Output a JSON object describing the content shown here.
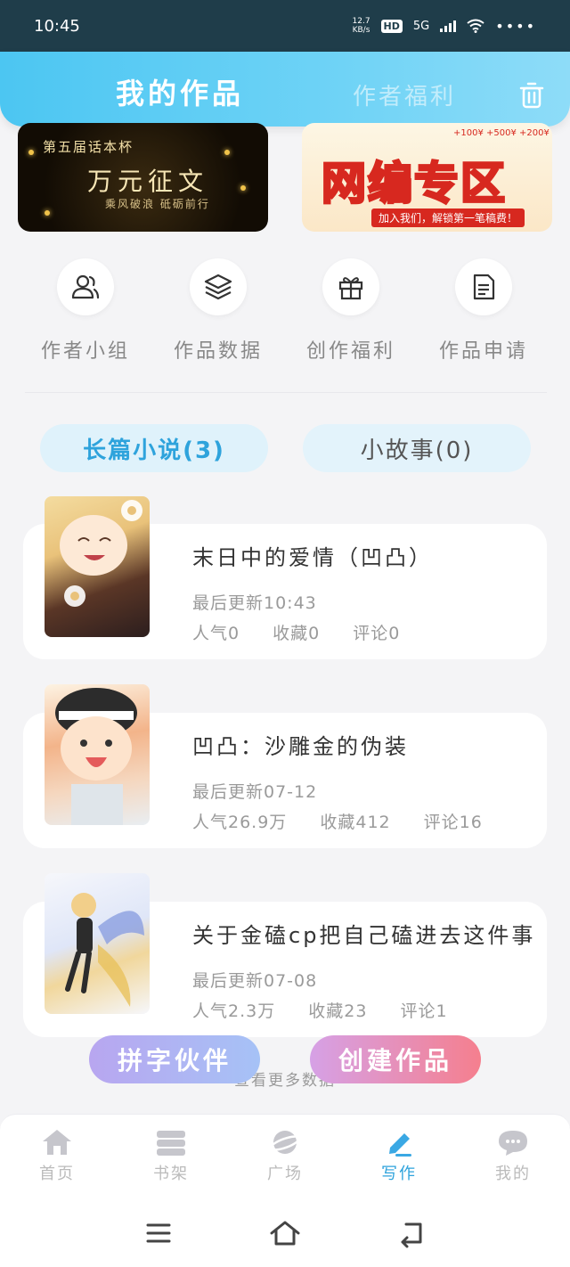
{
  "status_bar": {
    "time": "10:45",
    "net_speed_top": "12.7",
    "net_speed_bottom": "KB/s",
    "hd": "HD",
    "network": "5G",
    "more": "••••"
  },
  "header": {
    "title": "我的作品",
    "tab_welfare": "作者福利",
    "trash_icon": "trash-icon"
  },
  "banners": [
    {
      "line1": "第五届话本杯",
      "line2": "万元征文",
      "line3": "乘风破浪 砥砺前行"
    },
    {
      "main": "网编专区",
      "sub": "加入我们，解锁第一笔稿费！",
      "money": "+100¥  +500¥  +200¥"
    }
  ],
  "quick_actions": [
    {
      "label": "作者小组",
      "icon": "group-icon"
    },
    {
      "label": "作品数据",
      "icon": "layers-icon"
    },
    {
      "label": "创作福利",
      "icon": "gift-icon"
    },
    {
      "label": "作品申请",
      "icon": "document-icon"
    }
  ],
  "tabs": {
    "long": "长篇小说(3)",
    "short": "小故事(0)"
  },
  "works": [
    {
      "title": "末日中的爱情（凹凸）",
      "updated": "最后更新10:43",
      "popularity": "人气0",
      "favorites": "收藏0",
      "comments": "评论0"
    },
    {
      "title": "凹凸：沙雕金的伪装",
      "updated": "最后更新07-12",
      "popularity": "人气26.9万",
      "favorites": "收藏412",
      "comments": "评论16"
    },
    {
      "title": "关于金磕cp把自己磕进去这件事",
      "updated": "最后更新07-08",
      "popularity": "人气2.3万",
      "favorites": "收藏23",
      "comments": "评论1"
    }
  ],
  "actions": {
    "partner": "拼字伙伴",
    "create": "创建作品",
    "load_more": "查看更多数据"
  },
  "bottom_nav": [
    {
      "label": "首页",
      "icon": "home-icon"
    },
    {
      "label": "书架",
      "icon": "bookshelf-icon"
    },
    {
      "label": "广场",
      "icon": "planet-icon"
    },
    {
      "label": "写作",
      "icon": "pen-icon"
    },
    {
      "label": "我的",
      "icon": "chat-bubble-icon"
    }
  ],
  "colors": {
    "accent": "#2ea3dc",
    "header_gradient_start": "#4cc6f2",
    "create_button": "#f57f8e"
  }
}
